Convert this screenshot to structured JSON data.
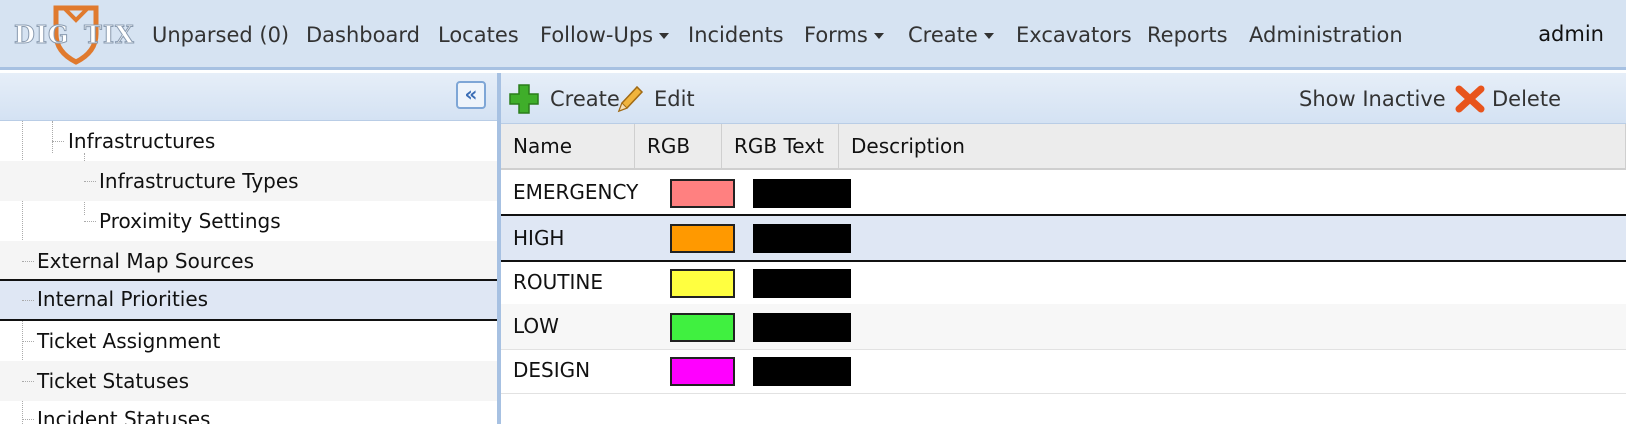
{
  "logo": {
    "text_left": "DIG",
    "text_right": "TIX"
  },
  "nav": {
    "items": [
      {
        "label": "Unparsed (0)",
        "dropdown": false
      },
      {
        "label": "Dashboard",
        "dropdown": false
      },
      {
        "label": "Locates",
        "dropdown": false
      },
      {
        "label": "Follow-Ups",
        "dropdown": true
      },
      {
        "label": "Incidents",
        "dropdown": false
      },
      {
        "label": "Forms",
        "dropdown": true
      },
      {
        "label": "Create",
        "dropdown": true
      },
      {
        "label": "Excavators",
        "dropdown": false
      },
      {
        "label": "Reports",
        "dropdown": false
      },
      {
        "label": "Administration",
        "dropdown": false
      }
    ],
    "user": "admin"
  },
  "tree": {
    "collapse_icon": "double-chevron-left-icon",
    "items": [
      {
        "label": "Infrastructures",
        "level": 1
      },
      {
        "label": "Infrastructure Types",
        "level": 2
      },
      {
        "label": "Proximity Settings",
        "level": 2
      },
      {
        "label": "External Map Sources",
        "level": 0
      },
      {
        "label": "Internal Priorities",
        "level": 0,
        "selected": true
      },
      {
        "label": "Ticket Assignment",
        "level": 0
      },
      {
        "label": "Ticket Statuses",
        "level": 0
      },
      {
        "label": "Incident Statuses",
        "level": 0
      }
    ]
  },
  "toolbar": {
    "create_label": "Create",
    "edit_label": "Edit",
    "show_inactive_label": "Show Inactive",
    "delete_label": "Delete"
  },
  "grid": {
    "columns": [
      "Name",
      "RGB",
      "RGB Text",
      "Description"
    ],
    "rows": [
      {
        "name": "EMERGENCY",
        "rgb": "#ff8080",
        "rgb_text": "#000000",
        "description": ""
      },
      {
        "name": "HIGH",
        "rgb": "#ff9900",
        "rgb_text": "#000000",
        "description": "",
        "selected": true
      },
      {
        "name": "ROUTINE",
        "rgb": "#ffff40",
        "rgb_text": "#000000",
        "description": ""
      },
      {
        "name": "LOW",
        "rgb": "#40f040",
        "rgb_text": "#000000",
        "description": ""
      },
      {
        "name": "DESIGN",
        "rgb": "#ff00ff",
        "rgb_text": "#000000",
        "description": ""
      }
    ]
  },
  "colors": {
    "nav_bg": "#d6e3f2",
    "accent_border": "#a7c1e2",
    "selected_row": "#dfe7f4",
    "logo_orange": "#e07a2e"
  }
}
